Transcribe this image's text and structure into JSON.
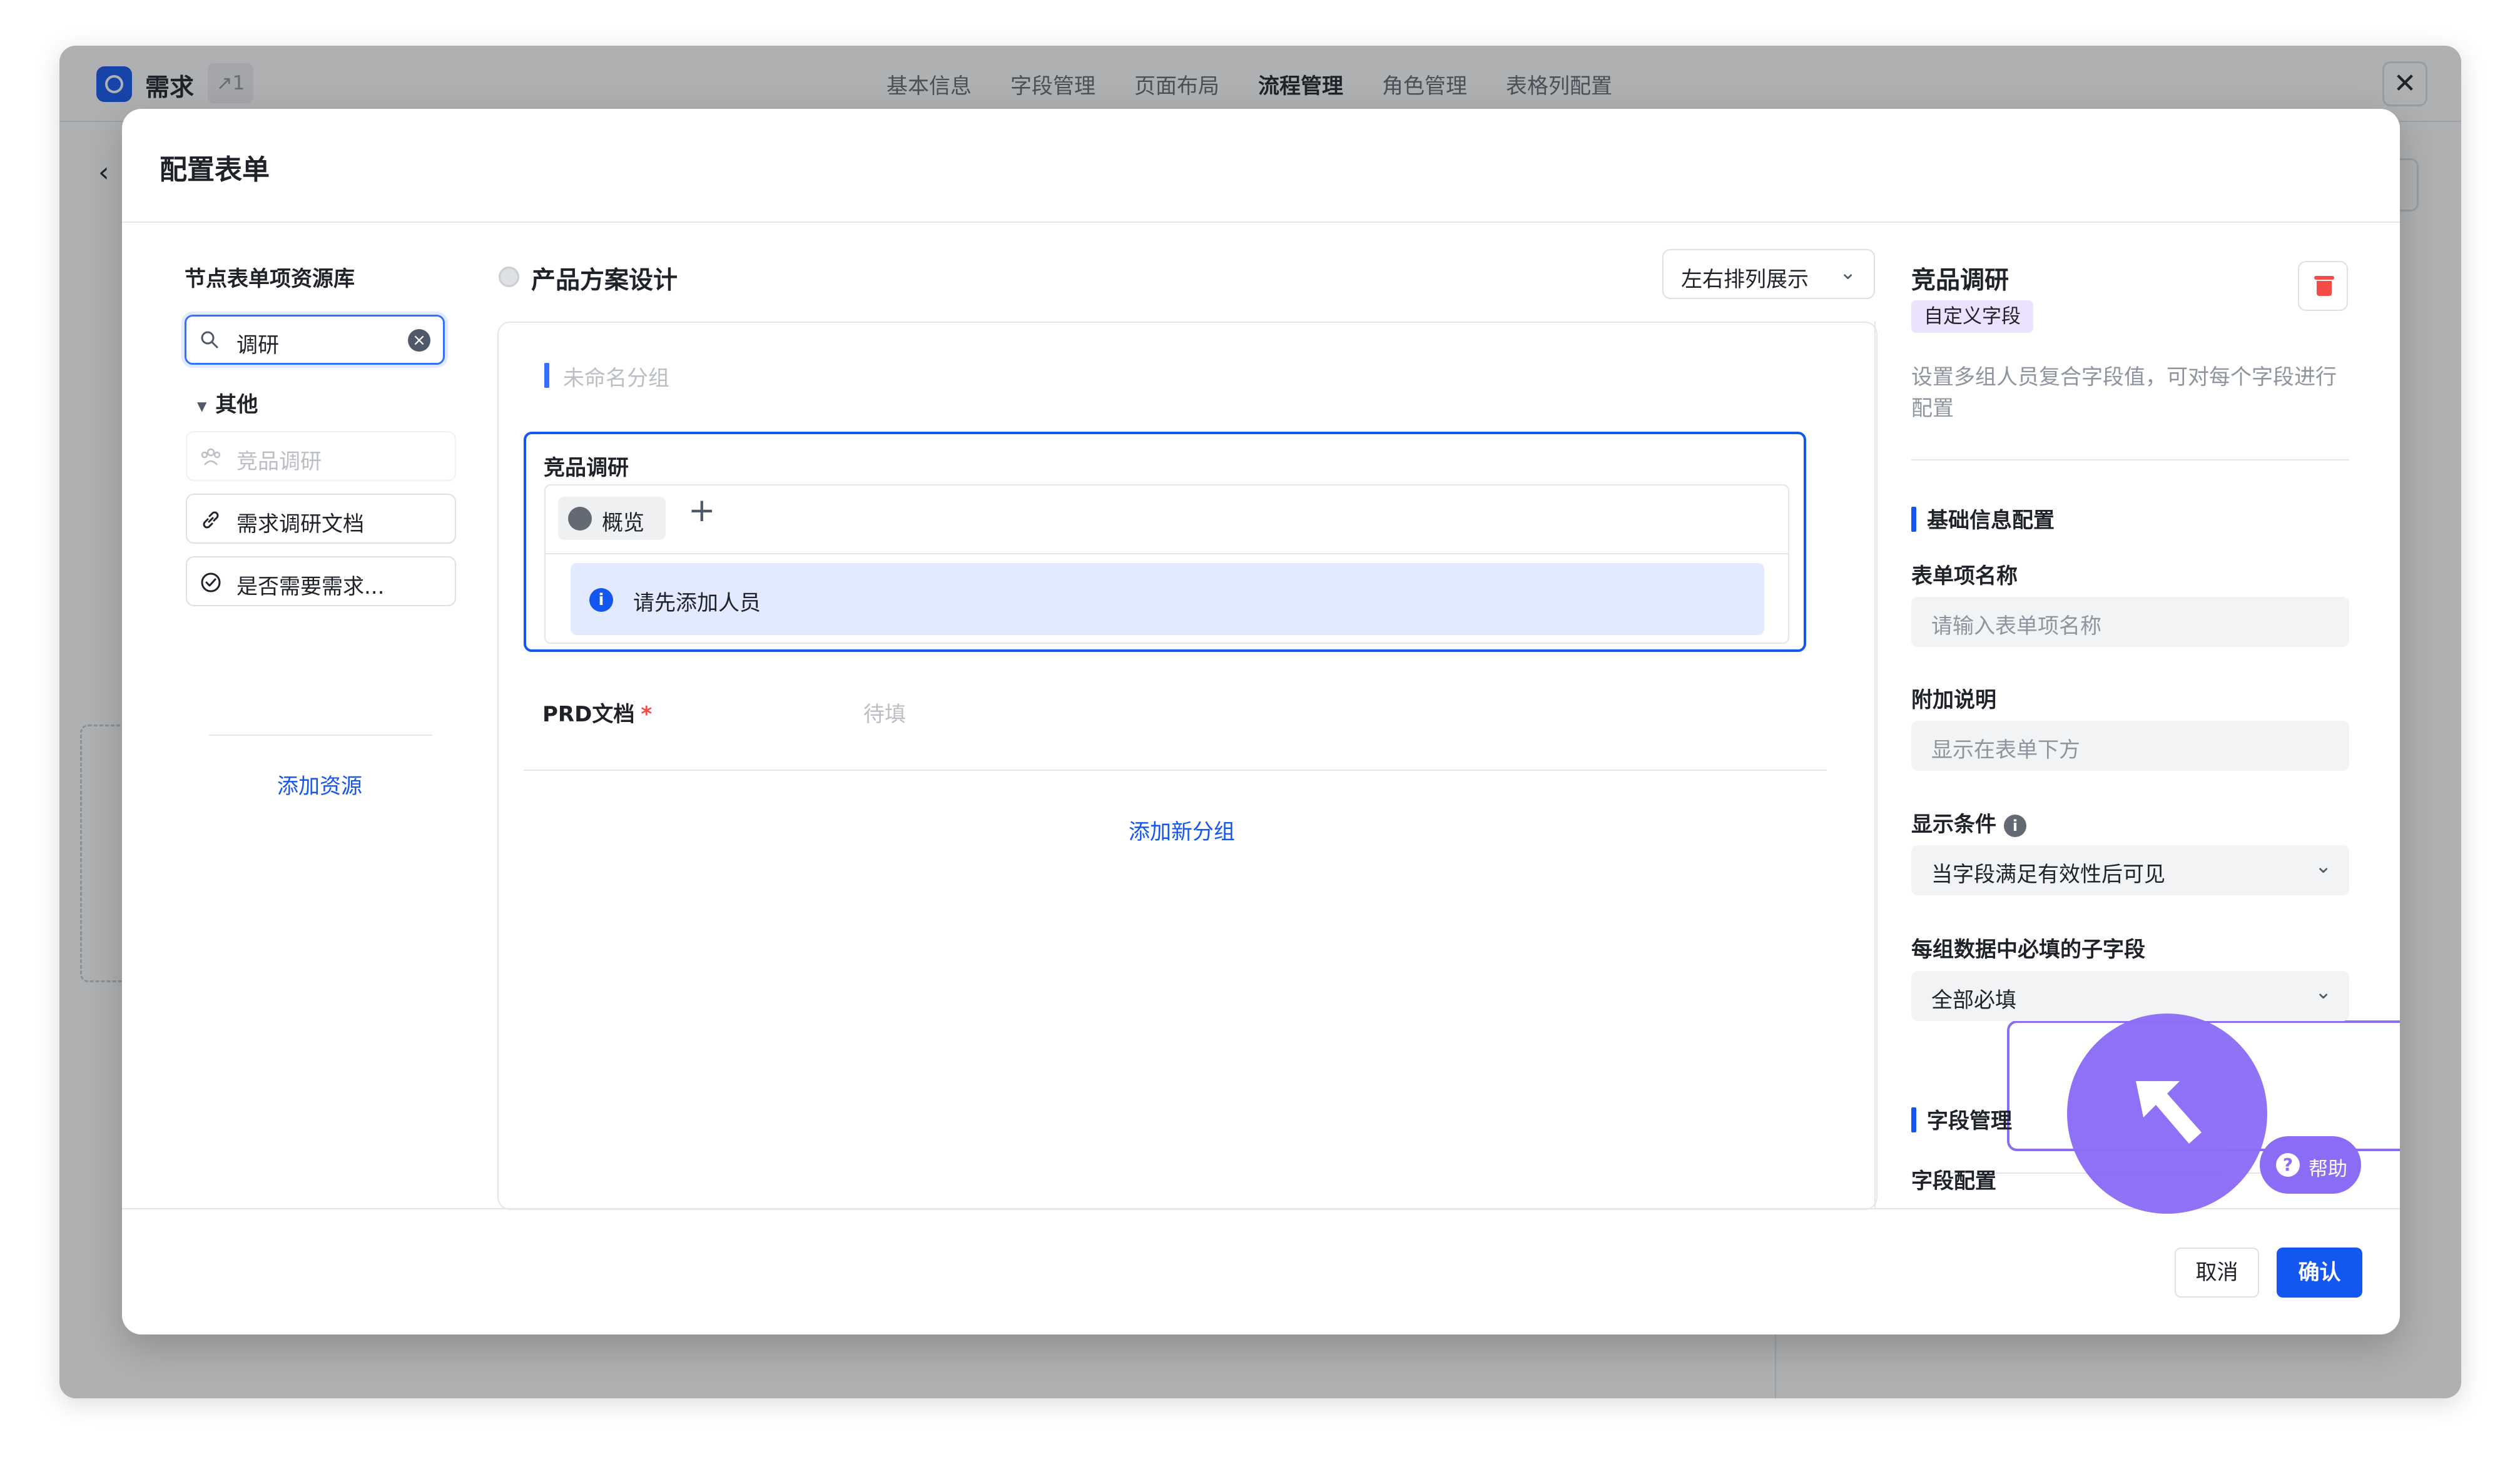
{
  "app": {
    "title": "需求",
    "counter": "↗1",
    "tabs": [
      "基本信息",
      "字段管理",
      "页面布局",
      "流程管理",
      "角色管理",
      "表格列配置"
    ],
    "active_tab": "流程管理",
    "close_glyph": "✕",
    "back_glyph": "‹"
  },
  "modal": {
    "title": "配置表单",
    "cancel_label": "取消",
    "confirm_label": "确认"
  },
  "library": {
    "title": "节点表单项资源库",
    "search_value": "调研",
    "group_label": "其他",
    "items": [
      {
        "label": "竞品调研",
        "icon": "people-group-icon",
        "disabled": true
      },
      {
        "label": "需求调研文档",
        "icon": "link-icon",
        "disabled": false
      },
      {
        "label": "是否需要需求...",
        "icon": "check-circle-icon",
        "disabled": false
      }
    ],
    "add_label": "添加资源"
  },
  "canvas": {
    "node_title": "产品方案设计",
    "layout_select": "左右排列展示",
    "group_placeholder": "未命名分组",
    "field_title": "竞品调研",
    "overview_tab": "概览",
    "add_glyph": "+",
    "info_text": "请先添加人员",
    "prd_label": "PRD文档",
    "prd_required": "*",
    "prd_placeholder": "待填",
    "add_group": "添加新分组"
  },
  "panel": {
    "title": "竞品调研",
    "tag": "自定义字段",
    "description": "设置多组人员复合字段值，可对每个字段进行配置",
    "basic_section": "基础信息配置",
    "name_label": "表单项名称",
    "name_placeholder": "请输入表单项名称",
    "note_label": "附加说明",
    "note_placeholder": "显示在表单下方",
    "condition_label": "显示条件",
    "condition_value": "当字段满足有效性后可见",
    "required_label": "每组数据中必填的子字段",
    "required_value": "全部必填",
    "field_section": "字段管理",
    "field_config_label": "字段配置"
  },
  "help": {
    "label": "帮助"
  },
  "colors": {
    "accent": "#1456f0",
    "cursor": "#8b6cf7",
    "danger": "#f54a45"
  }
}
